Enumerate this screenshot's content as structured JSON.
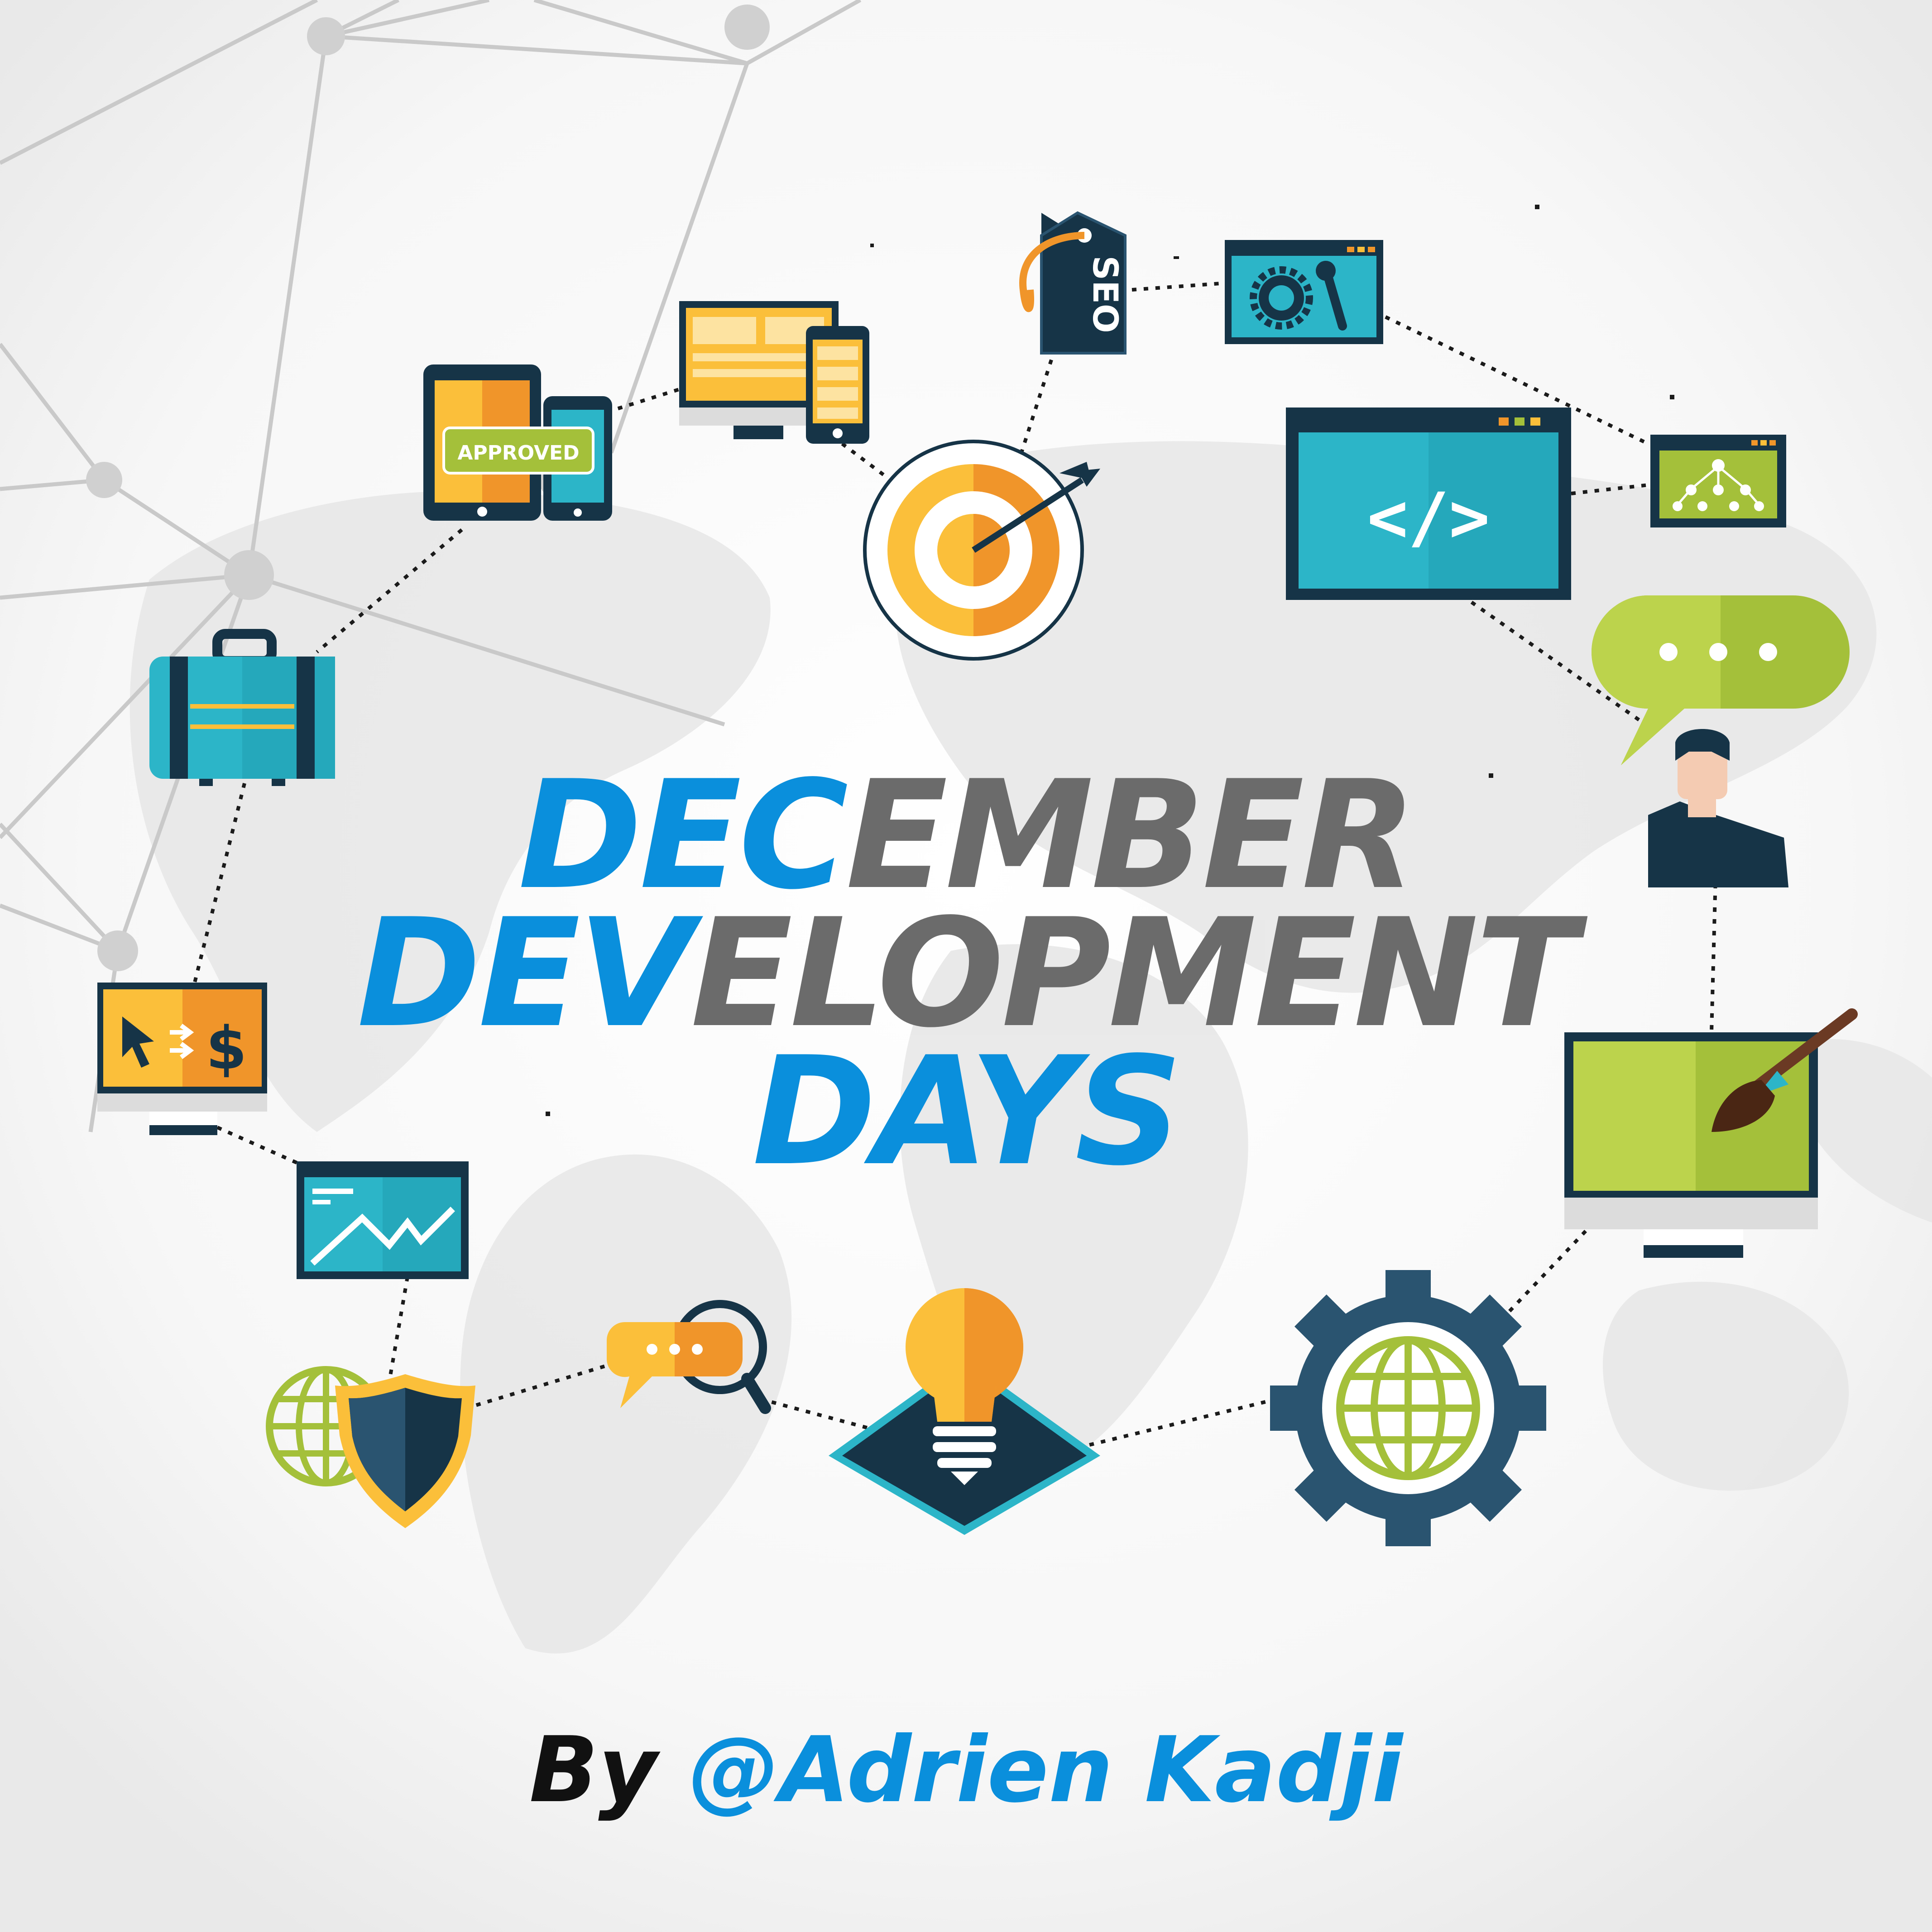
{
  "title": {
    "line1": {
      "accent": "DEC",
      "rest": "EMBER"
    },
    "line2": {
      "accent": "DEV",
      "rest": "ELOPMENT"
    },
    "line3": {
      "accent": "DAYS",
      "rest": ""
    }
  },
  "byline": {
    "prefix": "By",
    "author": "@Adrien Kadji"
  },
  "badges": {
    "approved": "APPROVED",
    "seo": "SEO",
    "code": "</>",
    "dollar": "$",
    "chat_dots": "..."
  },
  "colors": {
    "accent_blue": "#0a8fdc",
    "title_gray": "#6b6b6b",
    "byline_black": "#111111",
    "navy": "#163447",
    "teal": "#2cb5c8",
    "yellow": "#fbbf3a",
    "orange": "#f0952a",
    "green": "#a4c03a"
  },
  "icons": [
    "tablet-phone-icon",
    "desktop-phone-icon",
    "seo-tag-icon",
    "settings-window-icon",
    "target-icon",
    "code-window-icon",
    "sitemap-window-icon",
    "chat-bubble-icon",
    "user-avatar-icon",
    "briefcase-icon",
    "payment-monitor-icon",
    "analytics-window-icon",
    "globe-icon",
    "shield-icon",
    "chat-search-icon",
    "lightbulb-icon",
    "gear-globe-icon",
    "design-monitor-icon"
  ]
}
